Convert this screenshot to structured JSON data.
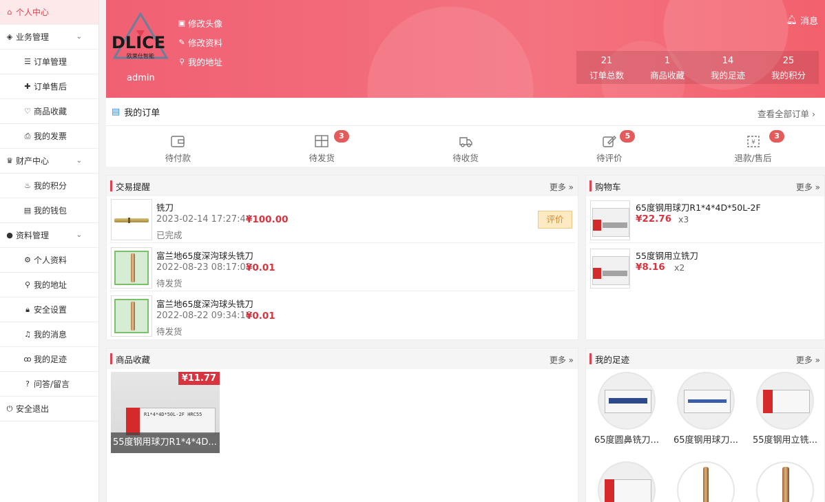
{
  "sidebar": {
    "items": [
      {
        "label": "个人中心",
        "icon": "home-icon"
      },
      {
        "label": "业务管理",
        "icon": "cube-icon"
      },
      {
        "label": "订单管理",
        "icon": "list-icon"
      },
      {
        "label": "订单售后",
        "icon": "puzzle-icon"
      },
      {
        "label": "商品收藏",
        "icon": "heart-icon"
      },
      {
        "label": "我的发票",
        "icon": "printer-icon"
      },
      {
        "label": "财产中心",
        "icon": "trophy-icon"
      },
      {
        "label": "我的积分",
        "icon": "fire-icon"
      },
      {
        "label": "我的钱包",
        "icon": "wallet-icon"
      },
      {
        "label": "资料管理",
        "icon": "user-icon"
      },
      {
        "label": "个人资料",
        "icon": "gear-icon"
      },
      {
        "label": "我的地址",
        "icon": "location-icon"
      },
      {
        "label": "安全设置",
        "icon": "lock-icon"
      },
      {
        "label": "我的消息",
        "icon": "bell-icon"
      },
      {
        "label": "我的足迹",
        "icon": "footprint-icon"
      },
      {
        "label": "问答/留言",
        "icon": "question-icon"
      },
      {
        "label": "安全退出",
        "icon": "power-icon"
      }
    ]
  },
  "banner": {
    "logo_text": "DLICE",
    "logo_sub": "欧莱仕智能",
    "username": "admin",
    "links": {
      "avatar": "修改头像",
      "profile": "修改资料",
      "address": "我的地址"
    },
    "message": "消息",
    "stats": [
      {
        "num": "21",
        "label": "订单总数"
      },
      {
        "num": "1",
        "label": "商品收藏"
      },
      {
        "num": "14",
        "label": "我的足迹"
      },
      {
        "num": "25",
        "label": "我的积分"
      }
    ]
  },
  "orders": {
    "title": "我的订单",
    "view_all": "查看全部订单",
    "statuses": [
      {
        "label": "待付款",
        "badge": "",
        "icon": "wallet-icon"
      },
      {
        "label": "待发货",
        "badge": "3",
        "icon": "package-icon"
      },
      {
        "label": "待收货",
        "badge": "",
        "icon": "truck-icon"
      },
      {
        "label": "待评价",
        "badge": "5",
        "icon": "edit-icon"
      },
      {
        "label": "退款/售后",
        "badge": "3",
        "icon": "refund-icon"
      }
    ]
  },
  "trade": {
    "title": "交易提醒",
    "more": "更多",
    "rows": [
      {
        "name": "铣刀",
        "date": "2023-02-14 17:27:44",
        "price": "¥100.00",
        "status": "已完成",
        "action": "评价"
      },
      {
        "name": "富兰地65度深沟球头铣刀",
        "date": "2022-08-23 08:17:03",
        "price": "¥0.01",
        "status": "待发货"
      },
      {
        "name": "富兰地65度深沟球头铣刀",
        "date": "2022-08-22 09:34:16",
        "price": "¥0.01",
        "status": "待发货"
      }
    ]
  },
  "cart": {
    "title": "购物车",
    "more": "更多",
    "rows": [
      {
        "name": "65度钢用球刀R1*4*4D*50L-2F",
        "price": "¥22.76",
        "qty": "x3"
      },
      {
        "name": "55度钢用立铣刀",
        "price": "¥8.16",
        "qty": "x2"
      }
    ]
  },
  "favorites": {
    "title": "商品收藏",
    "more": "更多",
    "items": [
      {
        "price": "¥11.77",
        "title": "55度钢用球刀R1*4*4D...",
        "box_text": "R1*4*4D*50L-2F HRC55"
      }
    ]
  },
  "footprints": {
    "title": "我的足迹",
    "more": "更多",
    "items": [
      {
        "label": "65度圆鼻铣刀..."
      },
      {
        "label": "65度钢用球刀..."
      },
      {
        "label": "55度钢用立铣..."
      },
      {
        "label": ""
      },
      {
        "label": ""
      },
      {
        "label": ""
      }
    ]
  },
  "colors": {
    "accent": "#e0404f",
    "price": "#d8343f",
    "banner": "#f06073",
    "badge": "#e35b5b"
  }
}
